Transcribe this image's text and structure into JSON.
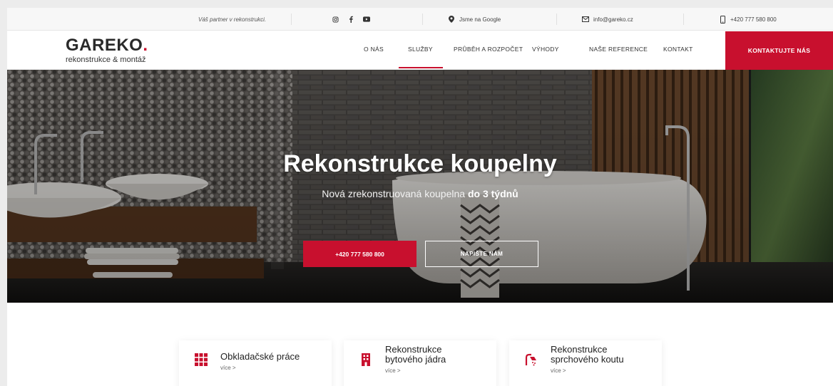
{
  "topbar": {
    "tagline": "Váš partner v rekonstrukci.",
    "social_icons": [
      "instagram-icon",
      "facebook-icon",
      "youtube-icon"
    ],
    "google_label": "Jsme na Google",
    "email": "info@gareko.cz",
    "phone": "+420 777 580 800"
  },
  "logo": {
    "prefix": "GA",
    "main": "REKO",
    "dot": ".",
    "tagline": "rekonstrukce & montáž"
  },
  "nav": {
    "items": [
      "O NÁS",
      "SLUŽBY",
      "PRŮBĚH A ROZPOČET",
      "VÝHODY",
      "NAŠE REFERENCE",
      "KONTAKT"
    ],
    "active": "SLUŽBY",
    "cta": "KONTAKTUJTE NÁS"
  },
  "hero": {
    "title": "Rekonstrukce koupelny",
    "subtitle_prefix": "Nová zrekonstruovaná koupelna ",
    "subtitle_bold": "do 3 týdnů",
    "phone_button": "+420 777 580 800",
    "write_button": "NAPIŠTE NÁM"
  },
  "services": [
    {
      "title_lines": [
        "Obkladačské práce"
      ],
      "more": "více >",
      "icon": "tiles-grid-icon"
    },
    {
      "title_lines": [
        "Rekonstrukce",
        "bytového jádra"
      ],
      "more": "více >",
      "icon": "building-icon"
    },
    {
      "title_lines": [
        "Rekonstrukce",
        "sprchového koutu"
      ],
      "more": "více >",
      "icon": "shower-icon"
    }
  ],
  "colors": {
    "brand_red": "#c8102e",
    "text_dark": "#222222",
    "topbar_bg": "#f7f7f7"
  }
}
